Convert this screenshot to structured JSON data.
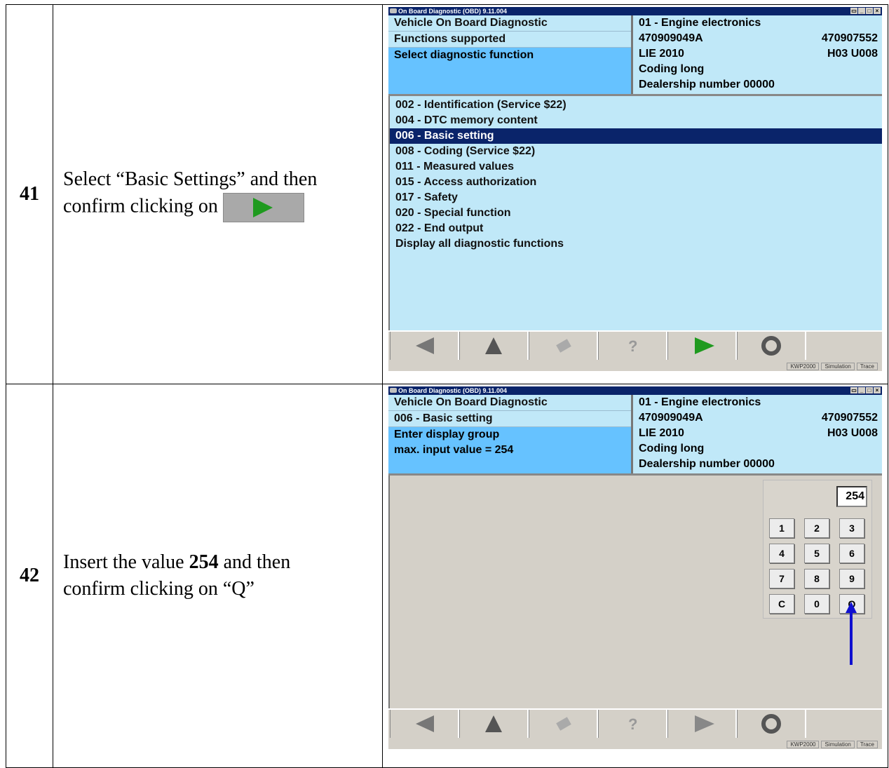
{
  "rows": [
    {
      "number": "41",
      "instruction_line1": "Select “Basic Settings” and then",
      "instruction_line2": "confirm clicking on"
    },
    {
      "number": "42",
      "instruction_part1": "Insert the value ",
      "instruction_bold": "254",
      "instruction_part2": " and then",
      "instruction_line2": "confirm clicking on “Q”"
    }
  ],
  "app": {
    "window_title": "On Board Diagnostic (OBD) 9.11.004",
    "status_items": [
      "KWP2000",
      "Simulation",
      "Trace"
    ],
    "ecu_info": {
      "module": "01 - Engine electronics",
      "part_number": "470909049A",
      "part_number_right": "470907552",
      "component": "LIE 2010",
      "version_right": "H03  U008",
      "coding": "Coding long",
      "dealer": "Dealership number 00000"
    },
    "screen1": {
      "header_lines": [
        "Vehicle On Board Diagnostic",
        "Functions supported"
      ],
      "selected_header": "Select diagnostic function",
      "functions": [
        "002 - Identification (Service $22)",
        "004 - DTC memory content",
        "006 - Basic setting",
        "008 - Coding (Service $22)",
        "011 - Measured values",
        "015 - Access authorization",
        "017 - Safety",
        "020 - Special function",
        "022 - End output",
        "Display all diagnostic functions"
      ],
      "active_function": "006 - Basic setting"
    },
    "screen2": {
      "header_lines": [
        "Vehicle On Board Diagnostic",
        "006 - Basic setting"
      ],
      "selected_header_1": "Enter display group",
      "selected_header_2": "max. input value = 254",
      "input_value": "254",
      "keys": [
        "1",
        "2",
        "3",
        "4",
        "5",
        "6",
        "7",
        "8",
        "9",
        "C",
        "0",
        "Q"
      ]
    }
  },
  "colors": {
    "panel_bg": "#c0e8f8",
    "selected_bg": "#66c2ff",
    "active_row": "#0a246a",
    "go_green": "#1f9a1f",
    "arrow_blue": "#1010d0"
  }
}
